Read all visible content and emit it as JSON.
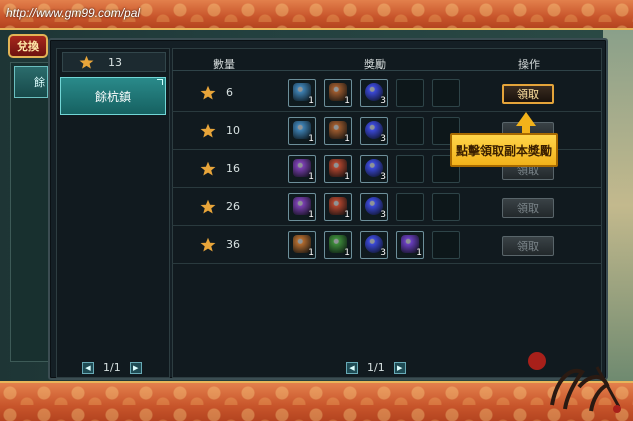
{
  "browser": {
    "url": "http://www.gm99.com/pal"
  },
  "side": {
    "tab_label": "兌換",
    "item_label": "餘"
  },
  "left_panel": {
    "star_total": "13",
    "region": "餘杭鎮",
    "pager": {
      "current": "1/1"
    }
  },
  "table": {
    "headers": {
      "count": "數量",
      "reward": "獎勵",
      "action": "操作"
    },
    "rows": [
      {
        "stars": "6",
        "button": "領取",
        "active": true,
        "items": [
          {
            "icon": "money-bag-icon",
            "qty": "1",
            "color": "#3d7fb0"
          },
          {
            "icon": "mushroom-icon",
            "qty": "1",
            "color": "#9b5a2e"
          },
          {
            "icon": "blue-orb-icon",
            "qty": "3",
            "color": "#3b48d6"
          }
        ]
      },
      {
        "stars": "10",
        "button": "",
        "active": false,
        "items": [
          {
            "icon": "money-bag-icon",
            "qty": "1",
            "color": "#3d7fb0"
          },
          {
            "icon": "mushroom-icon",
            "qty": "1",
            "color": "#9b5a2e"
          },
          {
            "icon": "blue-orb-icon",
            "qty": "3",
            "color": "#3b48d6"
          }
        ]
      },
      {
        "stars": "16",
        "button": "領取",
        "active": false,
        "items": [
          {
            "icon": "money-bag-icon",
            "qty": "1",
            "color": "#7a3fb0"
          },
          {
            "icon": "mushroom-icon",
            "qty": "1",
            "color": "#b0452e"
          },
          {
            "icon": "blue-orb-icon",
            "qty": "3",
            "color": "#3b48d6"
          }
        ]
      },
      {
        "stars": "26",
        "button": "領取",
        "active": false,
        "items": [
          {
            "icon": "money-bag-icon",
            "qty": "1",
            "color": "#7a3fb0"
          },
          {
            "icon": "mushroom-icon",
            "qty": "1",
            "color": "#b0452e"
          },
          {
            "icon": "blue-orb-icon",
            "qty": "3",
            "color": "#3b48d6"
          }
        ]
      },
      {
        "stars": "36",
        "button": "領取",
        "active": false,
        "items": [
          {
            "icon": "money-bag-icon",
            "qty": "1",
            "color": "#b06a2e"
          },
          {
            "icon": "herb-icon",
            "qty": "1",
            "color": "#3d8a3a"
          },
          {
            "icon": "blue-orb-icon",
            "qty": "3",
            "color": "#3b48d6"
          },
          {
            "icon": "purple-hood-icon",
            "qty": "1",
            "color": "#6a3fc0"
          }
        ]
      }
    ],
    "pager": {
      "current": "1/1"
    }
  },
  "tooltip": {
    "text": "點擊領取副本獎勵"
  },
  "colors": {
    "star": "#e8a53a",
    "accent": "#e4a43a",
    "teal": "#2a8a8a"
  }
}
